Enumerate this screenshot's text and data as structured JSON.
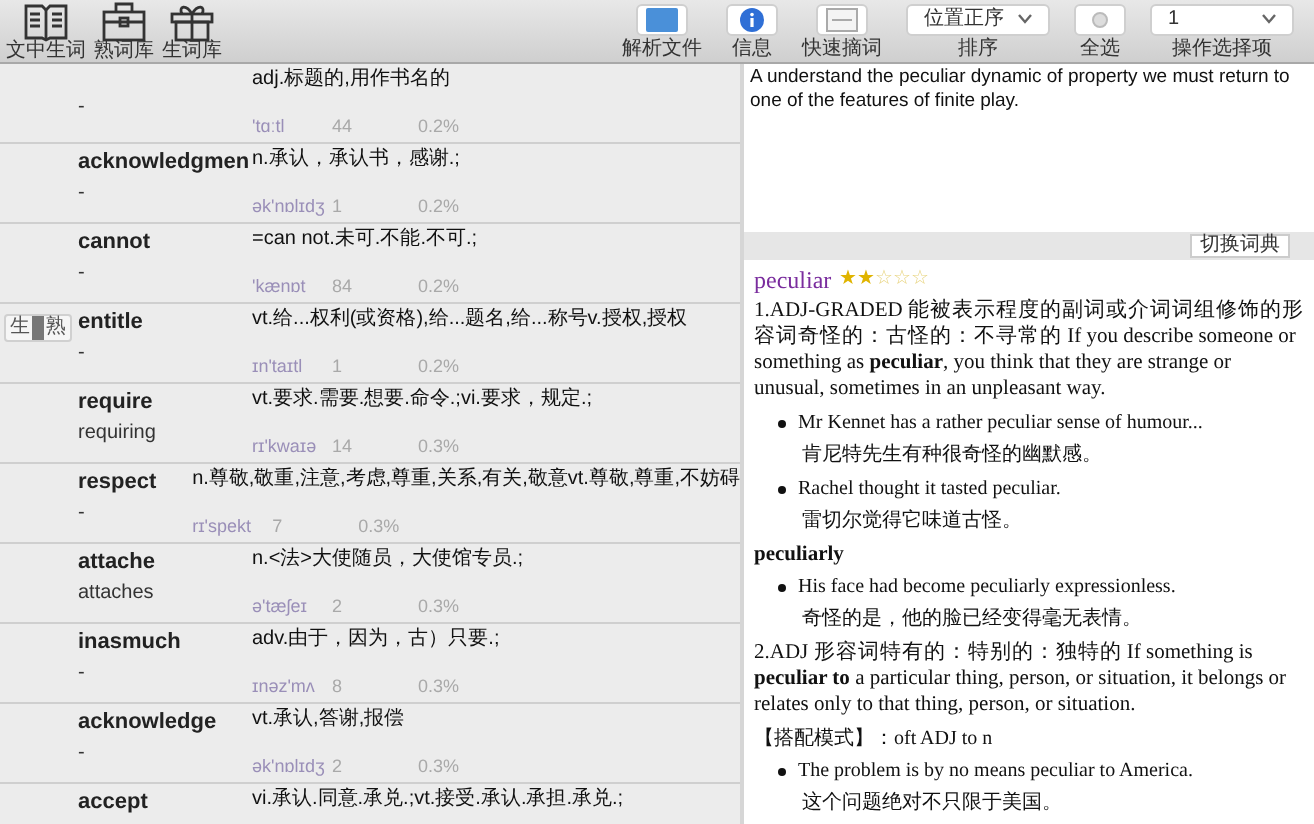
{
  "toolbar": {
    "left_tools": [
      {
        "label": "文中生词"
      },
      {
        "label": "熟词库"
      },
      {
        "label": "生词库"
      }
    ],
    "right_tools": [
      {
        "kind": "button",
        "label": "解析文件"
      },
      {
        "kind": "button",
        "label": "信息"
      },
      {
        "kind": "button",
        "label": "快速摘词"
      },
      {
        "kind": "dropdown",
        "label": "排序",
        "value": "位置正序"
      },
      {
        "kind": "toggle",
        "label": "全选"
      },
      {
        "kind": "dropdown",
        "label": "操作选择项",
        "value": "1"
      }
    ]
  },
  "switch": {
    "left": "生",
    "right": "熟"
  },
  "words": [
    {
      "definition": "adj.标题的,用作书名的",
      "form": "-",
      "phonetic": "'tɑːtl",
      "count": "44",
      "percent": "0.2%"
    },
    {
      "word": "acknowledgmen",
      "definition": "n.承认，承认书，感谢.;",
      "form": "-",
      "phonetic": "ək'nɒlɪdʒ",
      "count": "1",
      "percent": "0.2%"
    },
    {
      "word": "cannot",
      "definition": "=can not.未可.不能.不可.;",
      "form": "-",
      "phonetic": "'kænɒt",
      "count": "84",
      "percent": "0.2%"
    },
    {
      "word": "entitle",
      "definition": "vt.给...权利(或资格),给...题名,给...称号v.授权,授权",
      "form": "-",
      "phonetic": "ɪn'taɪtl",
      "count": "1",
      "percent": "0.2%"
    },
    {
      "word": "require",
      "definition": "vt.要求.需要.想要.命令.;vi.要求，规定.;",
      "form": "requiring",
      "phonetic": "rɪ'kwaɪə",
      "count": "14",
      "percent": "0.3%"
    },
    {
      "word": "respect",
      "definition": "n.尊敬,敬重,注意,考虑,尊重,关系,有关,敬意vt.尊敬,尊重,不妨碍",
      "form": "-",
      "phonetic": "rɪ'spekt",
      "count": "7",
      "percent": "0.3%"
    },
    {
      "word": "attache",
      "definition": "n.<法>大使随员，大使馆专员.;",
      "form": "attaches",
      "phonetic": "ə'tæʃeɪ",
      "count": "2",
      "percent": "0.3%"
    },
    {
      "word": "inasmuch",
      "definition": "adv.由于，因为，古）只要.;",
      "form": "-",
      "phonetic": "ɪnəz'mʌ",
      "count": "8",
      "percent": "0.3%"
    },
    {
      "word": "acknowledge",
      "definition": "vt.承认,答谢,报偿",
      "form": "-",
      "phonetic": "ək'nɒlɪdʒ",
      "count": "2",
      "percent": "0.3%"
    },
    {
      "word": "accept",
      "definition": "vi.承认.同意.承兑.;vt.接受.承认.承担.承兑.;"
    }
  ],
  "context": "A  understand the peculiar dynamic of property we must return to one of the features of finite play.",
  "switch_dict_button": "切换词典",
  "entry": {
    "headword": "peculiar",
    "stars": 2,
    "blocks": [
      {
        "kind": "sense",
        "text": "1.ADJ-GRADED 能被表示程度的副词或介词词组修饰的形容词奇怪的：古怪的：不寻常的 If you describe someone or something as **peculiar**, you think that they are strange or unusual, sometimes in an unpleasant way."
      },
      {
        "kind": "example",
        "text": "Mr Kennet has a rather peculiar sense of humour..."
      },
      {
        "kind": "translation",
        "text": "肯尼特先生有种很奇怪的幽默感。"
      },
      {
        "kind": "example",
        "text": "Rachel thought it tasted peculiar."
      },
      {
        "kind": "translation",
        "text": "雷切尔觉得它味道古怪。"
      },
      {
        "kind": "derived",
        "text": "peculiarly"
      },
      {
        "kind": "example",
        "text": "His face had become peculiarly expressionless."
      },
      {
        "kind": "translation",
        "text": "奇怪的是，他的脸已经变得毫无表情。"
      },
      {
        "kind": "sense",
        "text": "2.ADJ 形容词特有的：特别的：独特的 If something is **peculiar to** a particular thing, person, or situation, it belongs or relates only to that thing, person, or situation."
      },
      {
        "kind": "pattern",
        "text": "【搭配模式】：oft ADJ to n"
      },
      {
        "kind": "example",
        "text": "The problem is by no means peculiar to America."
      },
      {
        "kind": "translation",
        "text": "这个问题绝对不只限于美国。"
      }
    ]
  }
}
